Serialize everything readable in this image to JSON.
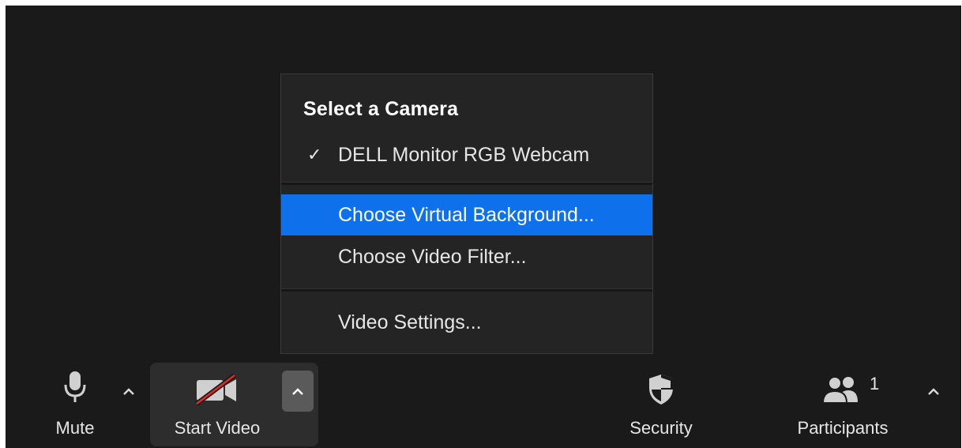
{
  "menu": {
    "header": "Select a Camera",
    "camera_item": {
      "check": "✓",
      "label": "DELL Monitor RGB Webcam"
    },
    "virtual_background": "Choose Virtual Background...",
    "video_filter": "Choose Video Filter...",
    "video_settings": "Video Settings..."
  },
  "toolbar": {
    "mute_label": "Mute",
    "start_video_label": "Start Video",
    "security_label": "Security",
    "participants_label": "Participants",
    "participants_count": "1",
    "caret": "^"
  },
  "icons": {
    "mic": "microphone-icon",
    "video_off": "video-off-icon",
    "security": "shield-icon",
    "participants": "participants-icon",
    "caret": "caret-up-icon"
  },
  "colors": {
    "accent": "#0e71eb",
    "background": "#1a1a1a",
    "menu_background": "#242424",
    "video_off_slash": "#e02828"
  }
}
